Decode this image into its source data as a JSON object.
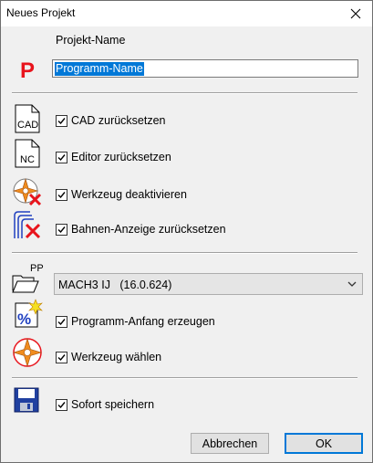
{
  "window": {
    "title": "Neues Projekt"
  },
  "project": {
    "label": "Projekt-Name",
    "value": "Programm-Name",
    "icon_letter": "P"
  },
  "options": {
    "cad": "CAD zurücksetzen",
    "editor": "Editor zurücksetzen",
    "tool_off": "Werkzeug deaktivieren",
    "paths": "Bahnen-Anzeige zurücksetzen"
  },
  "icons": {
    "cad_text": "CAD",
    "nc_text": "NC",
    "pp_text": "PP"
  },
  "postprocessor": {
    "name": "MACH3 IJ",
    "version": "(16.0.624)"
  },
  "program": {
    "start": "Programm-Anfang erzeugen",
    "tool_select": "Werkzeug wählen"
  },
  "save": {
    "label": "Sofort speichern"
  },
  "buttons": {
    "cancel": "Abbrechen",
    "ok": "OK"
  },
  "checked": {
    "cad": true,
    "editor": true,
    "tool_off": true,
    "paths": true,
    "start": true,
    "tool_select": true,
    "save": true
  },
  "colors": {
    "accent": "#0078d7",
    "red": "#e8141c",
    "orange": "#f08c1e"
  }
}
